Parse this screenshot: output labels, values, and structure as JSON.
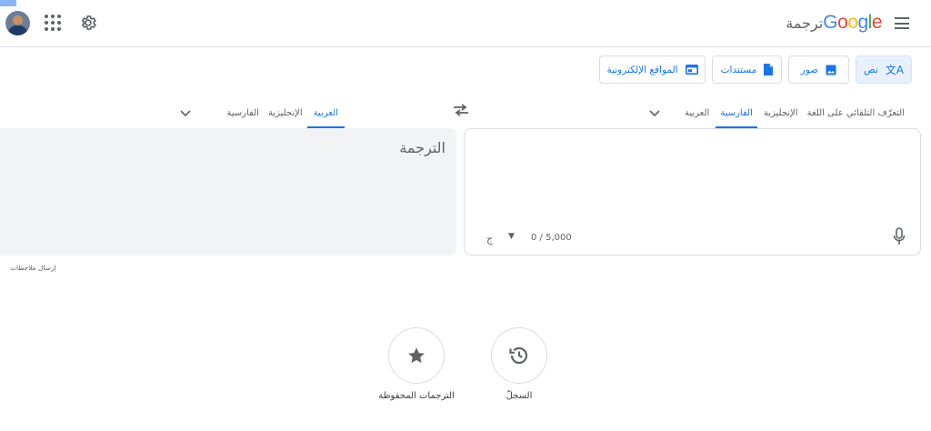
{
  "header": {
    "brand_google": "Google",
    "brand_product": "ترجمة",
    "avatar_alt": "avatar",
    "icons": [
      "apps-icon",
      "gear-icon",
      "menu-icon"
    ]
  },
  "modes": [
    {
      "label": "نص",
      "icon": "translate-icon",
      "active": true
    },
    {
      "label": "صور",
      "icon": "image-icon",
      "active": false
    },
    {
      "label": "مستندات",
      "icon": "document-icon",
      "active": false
    },
    {
      "label": "المواقع الإلكترونية",
      "icon": "website-icon",
      "active": false
    }
  ],
  "source_langs": [
    "التعرّف التلقائي على اللغة",
    "الإنجليزية",
    "الفارسية",
    "العربية"
  ],
  "source_active": "الفارسية",
  "target_langs": [
    "العربية",
    "الإنجليزية",
    "الفارسية"
  ],
  "target_active": "العربية",
  "swap_icon": "swap-icon",
  "source": {
    "char_count": "0 / 5,000",
    "keyboard_icon": "ج",
    "mic_icon": "microphone-icon"
  },
  "target": {
    "placeholder": "الترجمة"
  },
  "feedback": "إرسال ملاحظات",
  "bottom": {
    "history_label": "السجلّ",
    "saved_label": "الترجمات المحفوظة"
  },
  "colors": {
    "accent": "#1a73e8",
    "active_bg": "#e8f0fe",
    "panel_bg": "#f1f3f4",
    "border": "#dadce0",
    "google_blue": "#4285f4",
    "google_red": "#ea4335",
    "google_yellow": "#fbbc05",
    "google_green": "#34a853"
  }
}
